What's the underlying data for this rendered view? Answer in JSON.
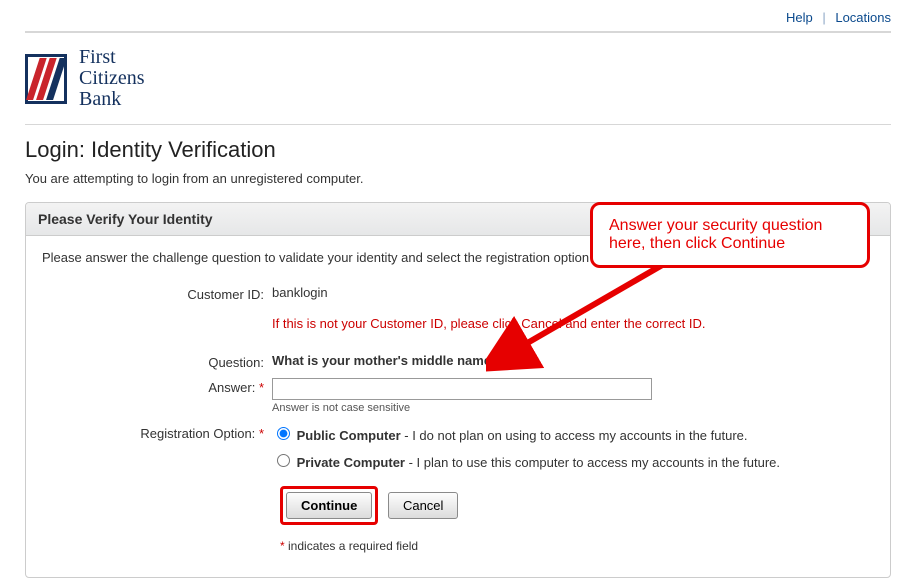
{
  "topnav": {
    "help": "Help",
    "locations": "Locations"
  },
  "logo": {
    "line1": "First",
    "line2": "Citizens",
    "line3": "Bank"
  },
  "page": {
    "title": "Login: Identity Verification",
    "subtitle": "You are attempting to login from an unregistered computer."
  },
  "panel": {
    "heading": "Please Verify Your Identity",
    "lead": "Please answer the challenge question to validate your identity and select the registration option below.",
    "customer_id_label": "Customer ID:",
    "customer_id_value": "banklogin",
    "not_your_id_warning": "If this is not your Customer ID, please click Cancel and enter the correct ID.",
    "question_label": "Question:",
    "question_text": "What is your mother's middle name?",
    "answer_label": "Answer:",
    "answer_value": "",
    "answer_hint": "Answer is not case sensitive",
    "reg_label": "Registration Option:",
    "opt_public_title": "Public Computer",
    "opt_public_desc": " - I do not plan on using to access my accounts in the future.",
    "opt_private_title": "Private Computer",
    "opt_private_desc": " - I plan to use this computer to access my accounts in the future.",
    "continue": "Continue",
    "cancel": "Cancel",
    "required_note": "indicates a required field"
  },
  "callout": {
    "text": "Answer your security question here, then click Continue"
  }
}
